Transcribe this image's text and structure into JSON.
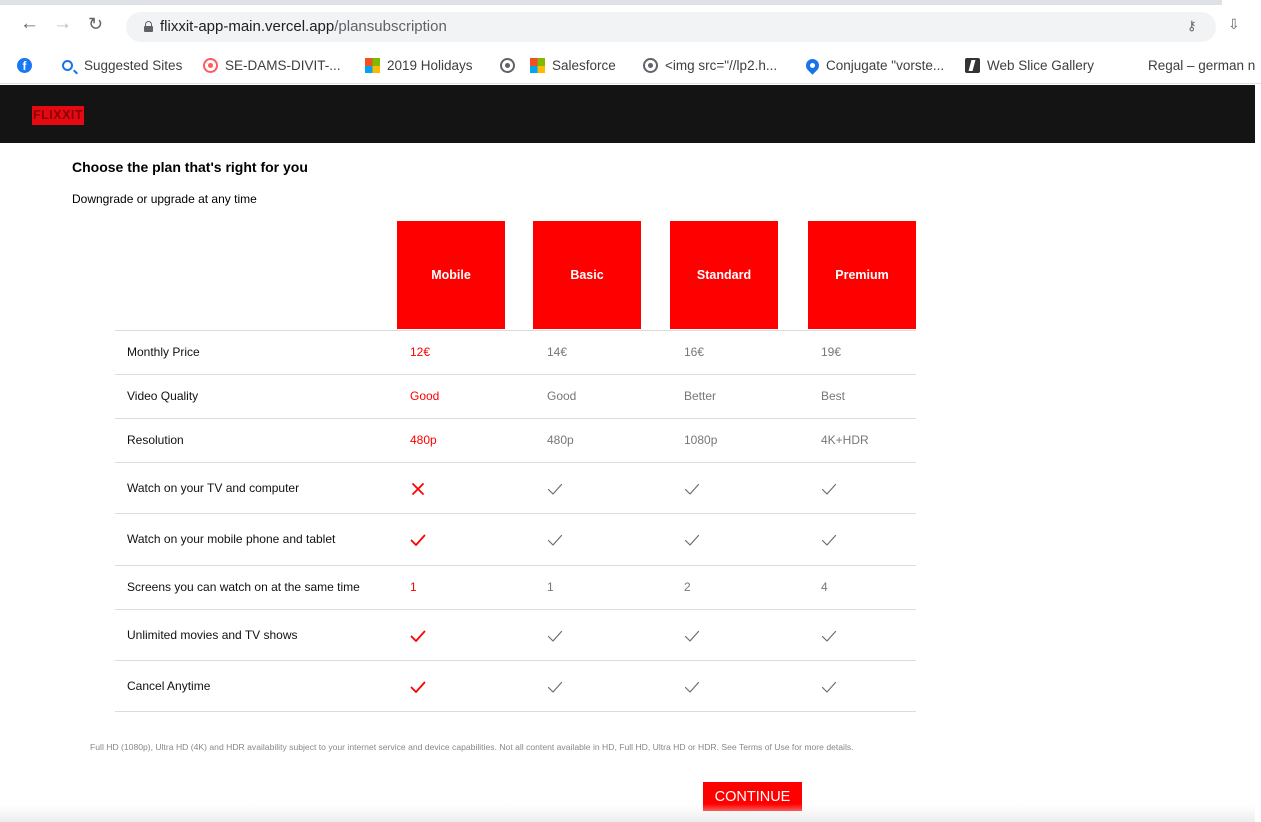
{
  "browser": {
    "url_domain": "flixxit-app-main.vercel.app",
    "url_path": "/plansubscription",
    "icons": [
      "back-icon",
      "forward-icon",
      "reload-icon",
      "lock-icon",
      "key-icon",
      "install-icon"
    ],
    "bookmarks": [
      {
        "label": "Suggested Sites",
        "icon": "search-icon"
      },
      {
        "label": "SE-DAMS-DIVIT-...",
        "icon": "circle-icon"
      },
      {
        "label": "2019 Holidays",
        "icon": "microsoft-icon"
      },
      {
        "label": "Salesforce",
        "icon": "microsoft-icon"
      },
      {
        "label": "<img src=\"//lp2.h...",
        "icon": "globe-icon"
      },
      {
        "label": "Conjugate \"vorste...",
        "icon": "chat-bubble-icon"
      },
      {
        "label": "Web Slice Gallery",
        "icon": "web-slice-icon"
      },
      {
        "label": "Regal – german n",
        "icon": ""
      }
    ]
  },
  "header": {
    "logo": "FLIXXIT",
    "background": "#141414",
    "accent": "#ff0000"
  },
  "page": {
    "title": "Choose the plan that's right for you",
    "subtitle": "Downgrade or upgrade at any time"
  },
  "plans": [
    "Mobile",
    "Basic",
    "Standard",
    "Premium"
  ],
  "selected_plan": "Mobile",
  "rows": [
    {
      "label": "Monthly Price",
      "values": [
        "12€",
        "14€",
        "16€",
        "19€"
      ]
    },
    {
      "label": "Video Quality",
      "values": [
        "Good",
        "Good",
        "Better",
        "Best"
      ]
    },
    {
      "label": "Resolution",
      "values": [
        "480p",
        "480p",
        "1080p",
        "4K+HDR"
      ]
    },
    {
      "label": "Watch on your TV and computer",
      "values": [
        "cross",
        "check",
        "check",
        "check"
      ]
    },
    {
      "label": "Watch on your mobile phone and tablet",
      "values": [
        "check",
        "check",
        "check",
        "check"
      ]
    },
    {
      "label": "Screens you can watch on at the same time",
      "values": [
        "1",
        "1",
        "2",
        "4"
      ]
    },
    {
      "label": "Unlimited movies and TV shows",
      "values": [
        "check",
        "check",
        "check",
        "check"
      ]
    },
    {
      "label": "Cancel Anytime",
      "values": [
        "check",
        "check",
        "check",
        "check"
      ]
    }
  ],
  "disclaimer": "Full HD (1080p), Ultra HD (4K) and HDR availability subject to your internet service and device capabilities. Not all content available in HD, Full HD, Ultra HD or HDR. See Terms of Use for more details.",
  "continue_label": "CONTINUE"
}
